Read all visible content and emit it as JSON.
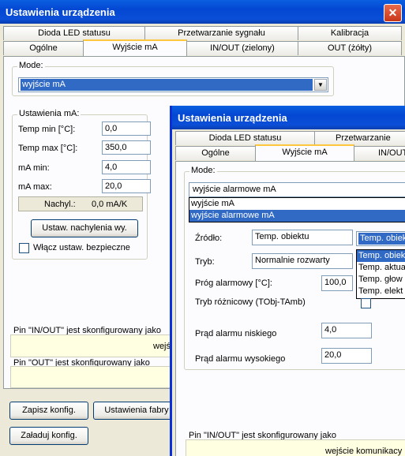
{
  "back": {
    "title": "Ustawienia urządzenia",
    "tabs_row1": [
      "Dioda LED statusu",
      "Przetwarzanie sygnału",
      "Kalibracja"
    ],
    "tabs_row2": [
      "Ogólne",
      "Wyjście mA",
      "IN/OUT (zielony)",
      "OUT (żółty)"
    ],
    "mode_label": "Mode:",
    "mode_value": "wyjście mA",
    "ma_group_label": "Ustawienia mA:",
    "temp_min_label": "Temp min [°C]:",
    "temp_min_value": "0,0",
    "temp_max_label": "Temp max [°C]:",
    "temp_max_value": "350,0",
    "ma_min_label": "mA min:",
    "ma_min_value": "4,0",
    "ma_max_label": "mA max:",
    "ma_max_value": "20,0",
    "slope_label": "Nachyl.:",
    "slope_value": "0,0 mA/K",
    "slope_button": "Ustaw. nachylenia wy.",
    "safe_checkbox": "Włącz ustaw. bezpieczne",
    "pin_inout_label": "Pin \"IN/OUT\" jest skonfigurowany jako",
    "pin_inout_value": "wejś",
    "pin_out_label": "Pin \"OUT\" jest skonfigurowany jako",
    "save_button": "Zapisz konfig.",
    "factory_button": "Ustawienia fabry",
    "load_button": "Załaduj konfig."
  },
  "front": {
    "title": "Ustawienia urządzenia",
    "tabs_row1": [
      "Dioda LED statusu",
      "Przetwarzanie"
    ],
    "tabs_row2": [
      "Ogólne",
      "Wyjście mA",
      "IN/OUT"
    ],
    "mode_label": "Mode:",
    "mode_value": "wyjście alarmowe mA",
    "mode_options": [
      "wyjście mA",
      "wyjście alarmowe mA"
    ],
    "source_label": "Źródło:",
    "source_value": "Temp. obiektu",
    "source_combo_value": "Temp. obiek",
    "source_options": [
      "Temp. obiek",
      "Temp. aktua",
      "Temp. głow",
      "Temp. elekt"
    ],
    "mode2_label": "Tryb:",
    "mode2_value": "Normalnie rozwarty",
    "threshold_label": "Próg alarmowy [°C]:",
    "threshold_value": "100,0",
    "diff_label": "Tryb różnicowy (TObj-TAmb)",
    "low_label": "Prąd alarmu niskiego",
    "low_value": "4,0",
    "high_label": "Prąd alarmu wysokiego",
    "high_value": "20,0",
    "pin_inout_label": "Pin \"IN/OUT\" jest skonfigurowany jako",
    "pin_inout_value": "wejście komunikacy"
  }
}
